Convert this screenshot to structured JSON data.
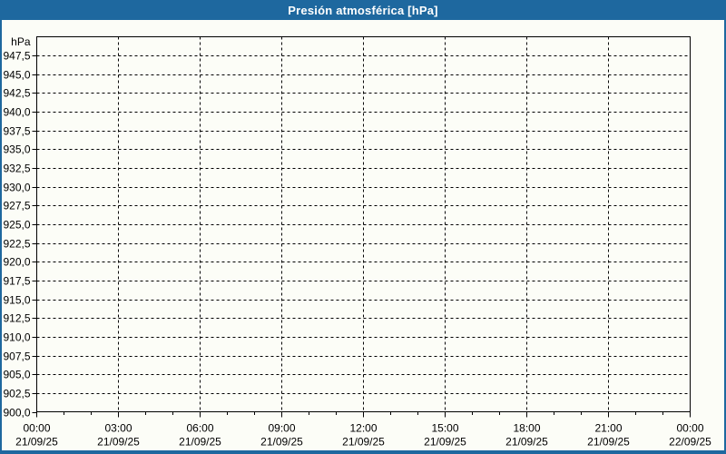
{
  "header": {
    "title": "Presión atmosférica [hPa]"
  },
  "colors": {
    "frame_blue": "#1E689F",
    "panel_background": "#FCFDF7",
    "grid_and_text": "#000000",
    "title_text": "#FFFFFF"
  },
  "chart_data": {
    "type": "line",
    "title": "Presión atmosférica [hPa]",
    "xlabel": "",
    "ylabel": "hPa",
    "ylim": [
      900,
      950
    ],
    "xlim_hours": [
      0,
      24
    ],
    "y_tick_step": 2.5,
    "x_major_step_hours": 3,
    "x_minor_step_hours": 1,
    "grid": "dashed",
    "legend": "none",
    "series": [],
    "y_ticks": [
      {
        "value": 947.5,
        "label": "947,5"
      },
      {
        "value": 945.0,
        "label": "945,0"
      },
      {
        "value": 942.5,
        "label": "942,5"
      },
      {
        "value": 940.0,
        "label": "940,0"
      },
      {
        "value": 937.5,
        "label": "937,5"
      },
      {
        "value": 935.0,
        "label": "935,0"
      },
      {
        "value": 932.5,
        "label": "932,5"
      },
      {
        "value": 930.0,
        "label": "930,0"
      },
      {
        "value": 927.5,
        "label": "927,5"
      },
      {
        "value": 925.0,
        "label": "925,0"
      },
      {
        "value": 922.5,
        "label": "922,5"
      },
      {
        "value": 920.0,
        "label": "920,0"
      },
      {
        "value": 917.5,
        "label": "917,5"
      },
      {
        "value": 915.0,
        "label": "915,0"
      },
      {
        "value": 912.5,
        "label": "912,5"
      },
      {
        "value": 910.0,
        "label": "910,0"
      },
      {
        "value": 907.5,
        "label": "907,5"
      },
      {
        "value": 905.0,
        "label": "905,0"
      },
      {
        "value": 902.5,
        "label": "902,5"
      },
      {
        "value": 900.0,
        "label": "900,0"
      }
    ],
    "x_ticks": [
      {
        "hour": 0,
        "time": "00:00",
        "date": "21/09/25"
      },
      {
        "hour": 3,
        "time": "03:00",
        "date": "21/09/25"
      },
      {
        "hour": 6,
        "time": "06:00",
        "date": "21/09/25"
      },
      {
        "hour": 9,
        "time": "09:00",
        "date": "21/09/25"
      },
      {
        "hour": 12,
        "time": "12:00",
        "date": "21/09/25"
      },
      {
        "hour": 15,
        "time": "15:00",
        "date": "21/09/25"
      },
      {
        "hour": 18,
        "time": "18:00",
        "date": "21/09/25"
      },
      {
        "hour": 21,
        "time": "21:00",
        "date": "21/09/25"
      },
      {
        "hour": 24,
        "time": "00:00",
        "date": "22/09/25"
      }
    ]
  }
}
